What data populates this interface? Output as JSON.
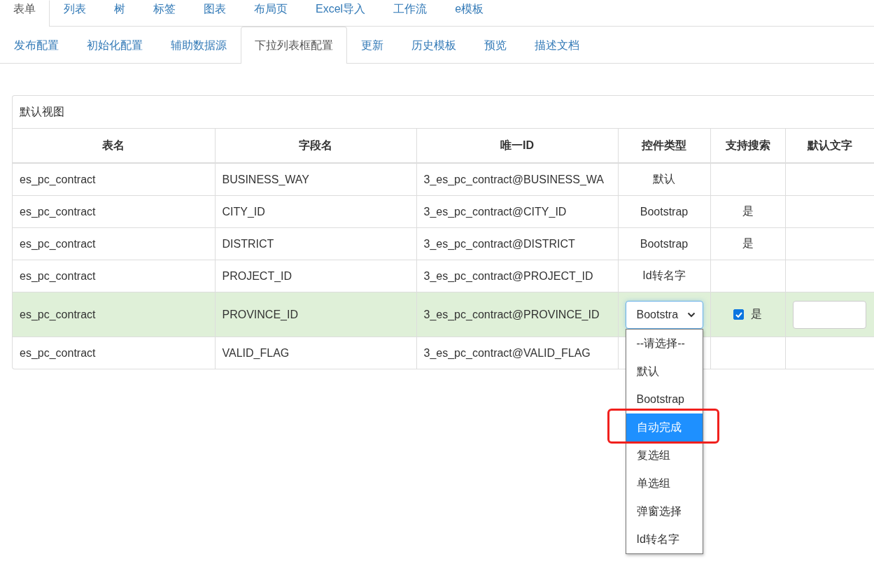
{
  "top_tabs": [
    {
      "label": "表单",
      "selected": true
    },
    {
      "label": "列表",
      "selected": false
    },
    {
      "label": "树",
      "selected": false
    },
    {
      "label": "标签",
      "selected": false
    },
    {
      "label": "图表",
      "selected": false
    },
    {
      "label": "布局页",
      "selected": false
    },
    {
      "label": "Excel导入",
      "selected": false
    },
    {
      "label": "工作流",
      "selected": false
    },
    {
      "label": "e模板",
      "selected": false
    }
  ],
  "sub_tabs": [
    {
      "label": "发布配置",
      "selected": false
    },
    {
      "label": "初始化配置",
      "selected": false
    },
    {
      "label": "辅助数据源",
      "selected": false
    },
    {
      "label": "下拉列表框配置",
      "selected": true
    },
    {
      "label": "更新",
      "selected": false
    },
    {
      "label": "历史模板",
      "selected": false
    },
    {
      "label": "预览",
      "selected": false
    },
    {
      "label": "描述文档",
      "selected": false
    }
  ],
  "panel": {
    "title": "默认视图",
    "columns": [
      "表名",
      "字段名",
      "唯一ID",
      "控件类型",
      "支持搜索",
      "默认文字"
    ],
    "rows": [
      {
        "kind": "view",
        "selected": false,
        "table": "es_pc_contract",
        "field": "BUSINESS_WAY",
        "uid": "3_es_pc_contract@BUSINESS_WA",
        "control_type": "默认"
      },
      {
        "kind": "view",
        "selected": false,
        "table": "es_pc_contract",
        "field": "CITY_ID",
        "uid": "3_es_pc_contract@CITY_ID",
        "control_type": "Bootstrap",
        "search": "是"
      },
      {
        "kind": "view",
        "selected": false,
        "table": "es_pc_contract",
        "field": "DISTRICT",
        "uid": "3_es_pc_contract@DISTRICT",
        "control_type": "Bootstrap",
        "search": "是"
      },
      {
        "kind": "view",
        "selected": false,
        "table": "es_pc_contract",
        "field": "PROJECT_ID",
        "uid": "3_es_pc_contract@PROJECT_ID",
        "control_type": "Id转名字"
      },
      {
        "kind": "edit",
        "selected": true,
        "table": "es_pc_contract",
        "field": "PROVINCE_ID",
        "uid": "3_es_pc_contract@PROVINCE_ID",
        "select_value": "Bootstra",
        "search_checked": true,
        "search": "是",
        "dropdown": [
          {
            "label": "--请选择--",
            "selected": false,
            "outlined": false
          },
          {
            "label": "默认",
            "selected": false,
            "outlined": false
          },
          {
            "label": "Bootstrap",
            "selected": false,
            "outlined": false
          },
          {
            "label": "自动完成",
            "selected": true,
            "outlined": true
          },
          {
            "label": "复选组",
            "selected": false,
            "outlined": false
          },
          {
            "label": "单选组",
            "selected": false,
            "outlined": false
          },
          {
            "label": "弹窗选择",
            "selected": false,
            "outlined": false
          },
          {
            "label": "Id转名字",
            "selected": false,
            "outlined": false
          }
        ]
      },
      {
        "kind": "view",
        "selected": false,
        "table": "es_pc_contract",
        "field": "VALID_FLAG",
        "uid": "3_es_pc_contract@VALID_FLAG"
      }
    ]
  }
}
